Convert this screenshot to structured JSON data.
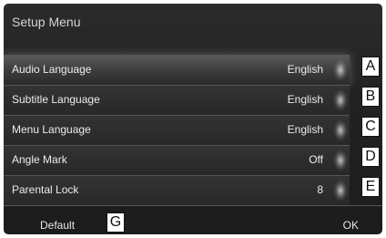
{
  "header": {
    "title": "Setup Menu"
  },
  "menu": {
    "items": [
      {
        "label": "Audio Language",
        "value": "English",
        "callout": "A"
      },
      {
        "label": "Subtitle Language",
        "value": "English",
        "callout": "B"
      },
      {
        "label": "Menu Language",
        "value": "English",
        "callout": "C"
      },
      {
        "label": "Angle Mark",
        "value": "Off",
        "callout": "D"
      },
      {
        "label": "Parental Lock",
        "value": "8",
        "callout": "E"
      }
    ]
  },
  "footer": {
    "default_label": "Default",
    "default_callout": "G",
    "ok_label": "OK"
  },
  "colors": {
    "background": "#222222",
    "text": "#ececec",
    "divider": "#555555"
  }
}
